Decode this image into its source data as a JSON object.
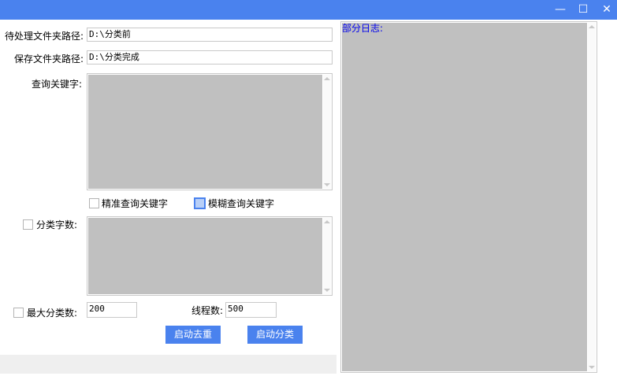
{
  "window": {
    "minimize_glyph": "—",
    "maximize_glyph": "☐",
    "close_glyph": "✕"
  },
  "form": {
    "input_path_label": "待处理文件夹路径:",
    "input_path_value": "D:\\分类前",
    "save_path_label": "保存文件夹路径:",
    "save_path_value": "D:\\分类完成",
    "keyword_label": "查询关键字:",
    "exact_keyword_label": "精准查询关键字",
    "fuzzy_keyword_label": "模糊查询关键字",
    "category_chars_label": "分类字数:",
    "max_categories_label": "最大分类数:",
    "max_categories_value": "200",
    "threads_label": "线程数:",
    "threads_value": "500"
  },
  "buttons": {
    "dedupe": "启动去重",
    "classify": "启动分类"
  },
  "log": {
    "title": "部分日志:"
  },
  "colors": {
    "accent": "#4a82ee",
    "memo_bg": "#c0c0c0",
    "log_title": "#0000ee"
  }
}
